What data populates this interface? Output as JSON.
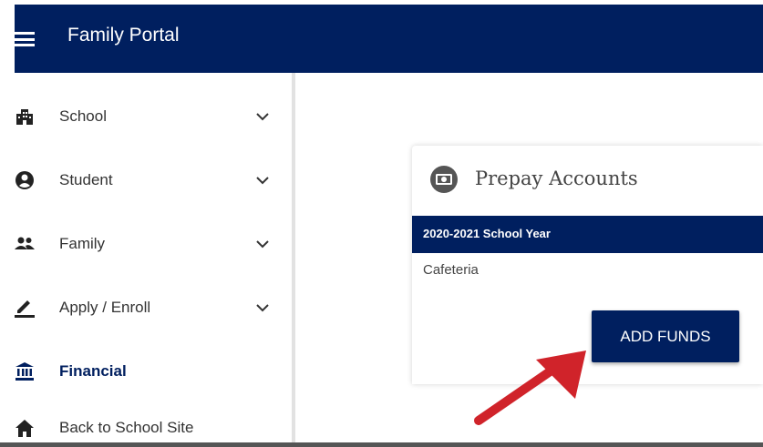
{
  "header": {
    "title": "Family Portal"
  },
  "sidebar": {
    "items": [
      {
        "label": "School",
        "icon": "building-icon",
        "expandable": true
      },
      {
        "label": "Student",
        "icon": "user-circle-icon",
        "expandable": true
      },
      {
        "label": "Family",
        "icon": "people-icon",
        "expandable": true
      },
      {
        "label": "Apply / Enroll",
        "icon": "pencil-icon",
        "expandable": true
      },
      {
        "label": "Financial",
        "icon": "bank-icon",
        "expandable": false,
        "active": true
      },
      {
        "label": "Back to School Site",
        "icon": "home-icon",
        "expandable": false
      }
    ]
  },
  "card": {
    "title": "Prepay Accounts",
    "icon": "money-icon",
    "year": "2020-2021 School Year",
    "account": "Cafeteria",
    "button_label": "ADD FUNDS"
  },
  "colors": {
    "brand": "#001f5f",
    "annotation_arrow": "#d0232a"
  }
}
